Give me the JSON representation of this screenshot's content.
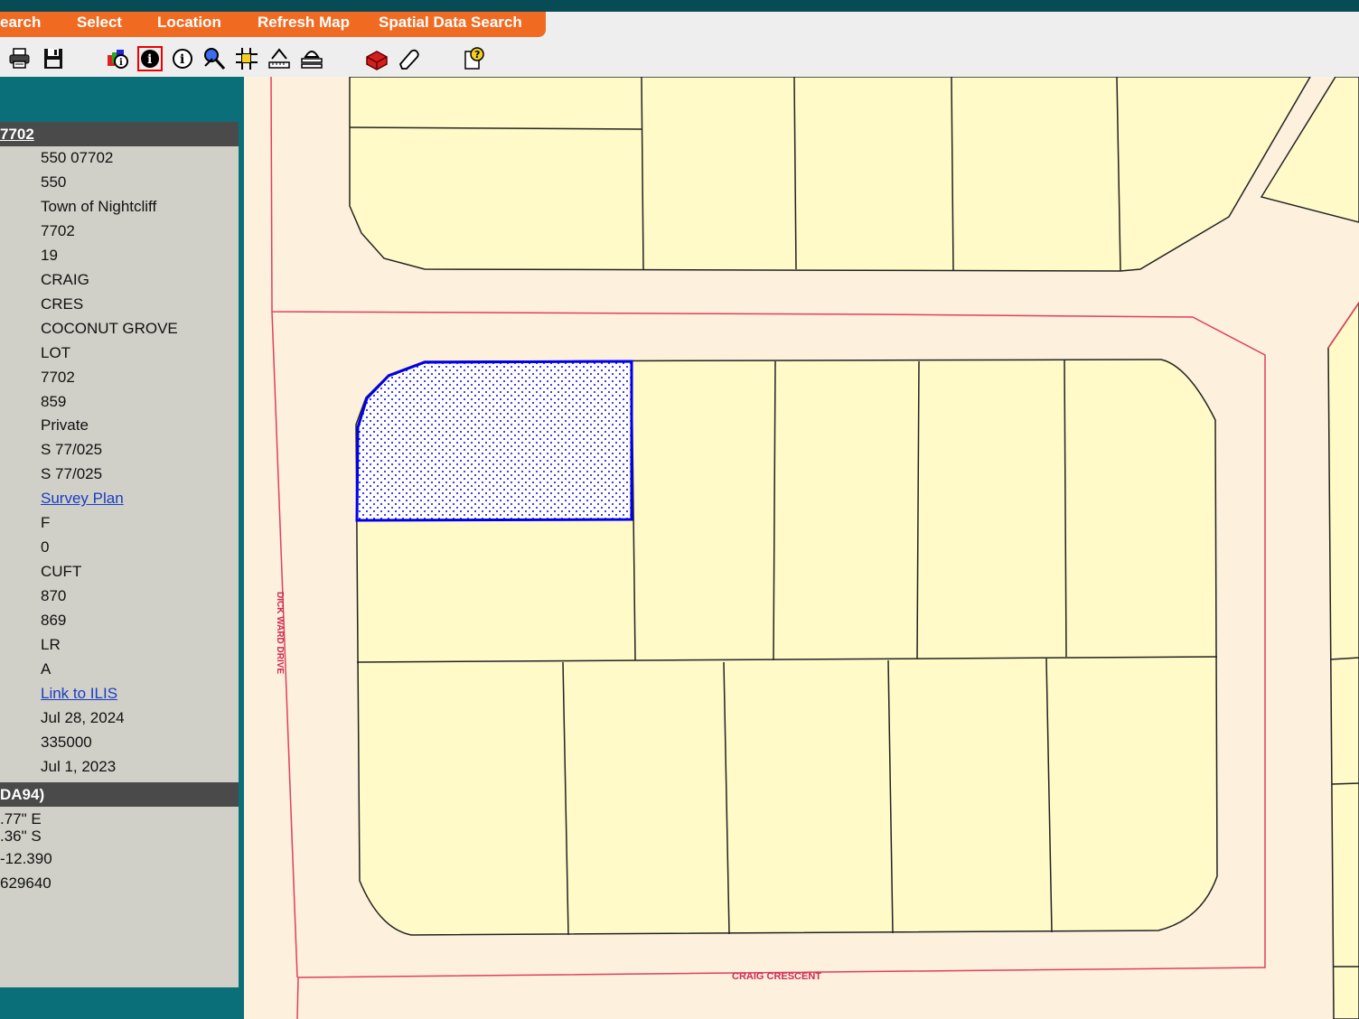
{
  "menu": {
    "items": [
      "earch",
      "Select",
      "Location",
      "Refresh Map",
      "Spatial Data Search"
    ]
  },
  "toolbar": {
    "tools": [
      "print-icon",
      "save-icon",
      "multi-identify-icon",
      "identify-icon",
      "info-icon",
      "select-tool-icon",
      "grid-icon",
      "measure-icon",
      "layer-icon",
      "toolbox-icon",
      "eraser-icon",
      "help-icon"
    ]
  },
  "panel": {
    "header1": "7702",
    "values": [
      "550     07702",
      "550",
      "Town of Nightcliff",
      "7702",
      "19",
      "CRAIG",
      "CRES",
      "COCONUT GROVE",
      "LOT",
      "7702",
      "859",
      "Private",
      "S 77/025",
      "S 77/025",
      "Survey Plan",
      "F",
      "0",
      "CUFT",
      "870",
      "869",
      "LR",
      "A",
      "Link to ILIS",
      "Jul 28, 2024",
      "335000",
      "Jul 1, 2023"
    ],
    "header2": "DA94)",
    "coords": [
      ".77\" E",
      ".36\" S",
      "-12.390",
      "629640"
    ]
  },
  "map": {
    "street_west": "DICK WARD DRIVE",
    "street_south": "CRAIG CRESCENT",
    "colors": {
      "road": "#fdf0dc",
      "parcel": "#fffac8",
      "boundary": "#e0405a",
      "selected": "#0000ee"
    }
  }
}
